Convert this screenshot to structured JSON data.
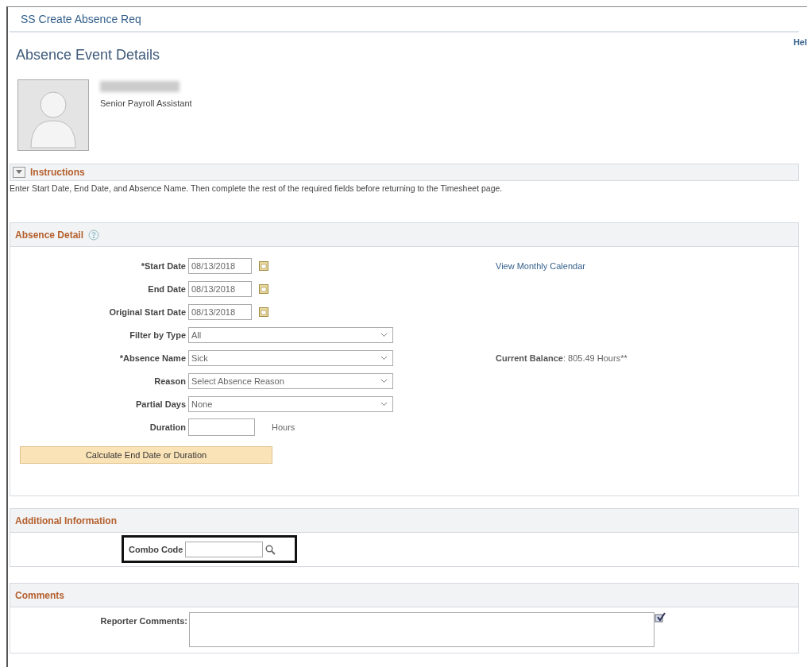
{
  "window": {
    "title": "SS Create Absence Req"
  },
  "help_link": "Hel",
  "page_title": "Absence Event Details",
  "employee": {
    "job_title": "Senior Payroll Assistant",
    "name_redacted": true
  },
  "instructions": {
    "title": "Instructions",
    "expanded": true,
    "text": "Enter Start Date, End Date, and Absence Name. Then complete the rest of the required fields before returning to the Timesheet page."
  },
  "absence_detail": {
    "title": "Absence Detail",
    "fields": [
      {
        "kind": "date",
        "label": "*Start Date",
        "value": "08/13/2018",
        "side_link": "View Monthly Calendar"
      },
      {
        "kind": "date",
        "label": "End Date",
        "value": "08/13/2018"
      },
      {
        "kind": "date",
        "label": "Original Start Date",
        "value": "08/13/2018"
      },
      {
        "kind": "select",
        "label": "Filter by Type",
        "value": "All"
      },
      {
        "kind": "select",
        "label": "*Absence Name",
        "value": "Sick",
        "side_label": "Current Balance",
        "side_value": ": 805.49 Hours**"
      },
      {
        "kind": "select",
        "label": "Reason",
        "value": "Select Absence Reason"
      },
      {
        "kind": "select",
        "label": "Partial Days",
        "value": "None"
      },
      {
        "kind": "number",
        "label": "Duration",
        "unit": "Hours"
      }
    ],
    "button": "Calculate End Date or Duration"
  },
  "additional_information": {
    "title": "Additional Information",
    "combo_code": {
      "label": "Combo Code",
      "highlighted": true
    }
  },
  "comments": {
    "title": "Comments",
    "label": "Reporter Comments:"
  }
}
